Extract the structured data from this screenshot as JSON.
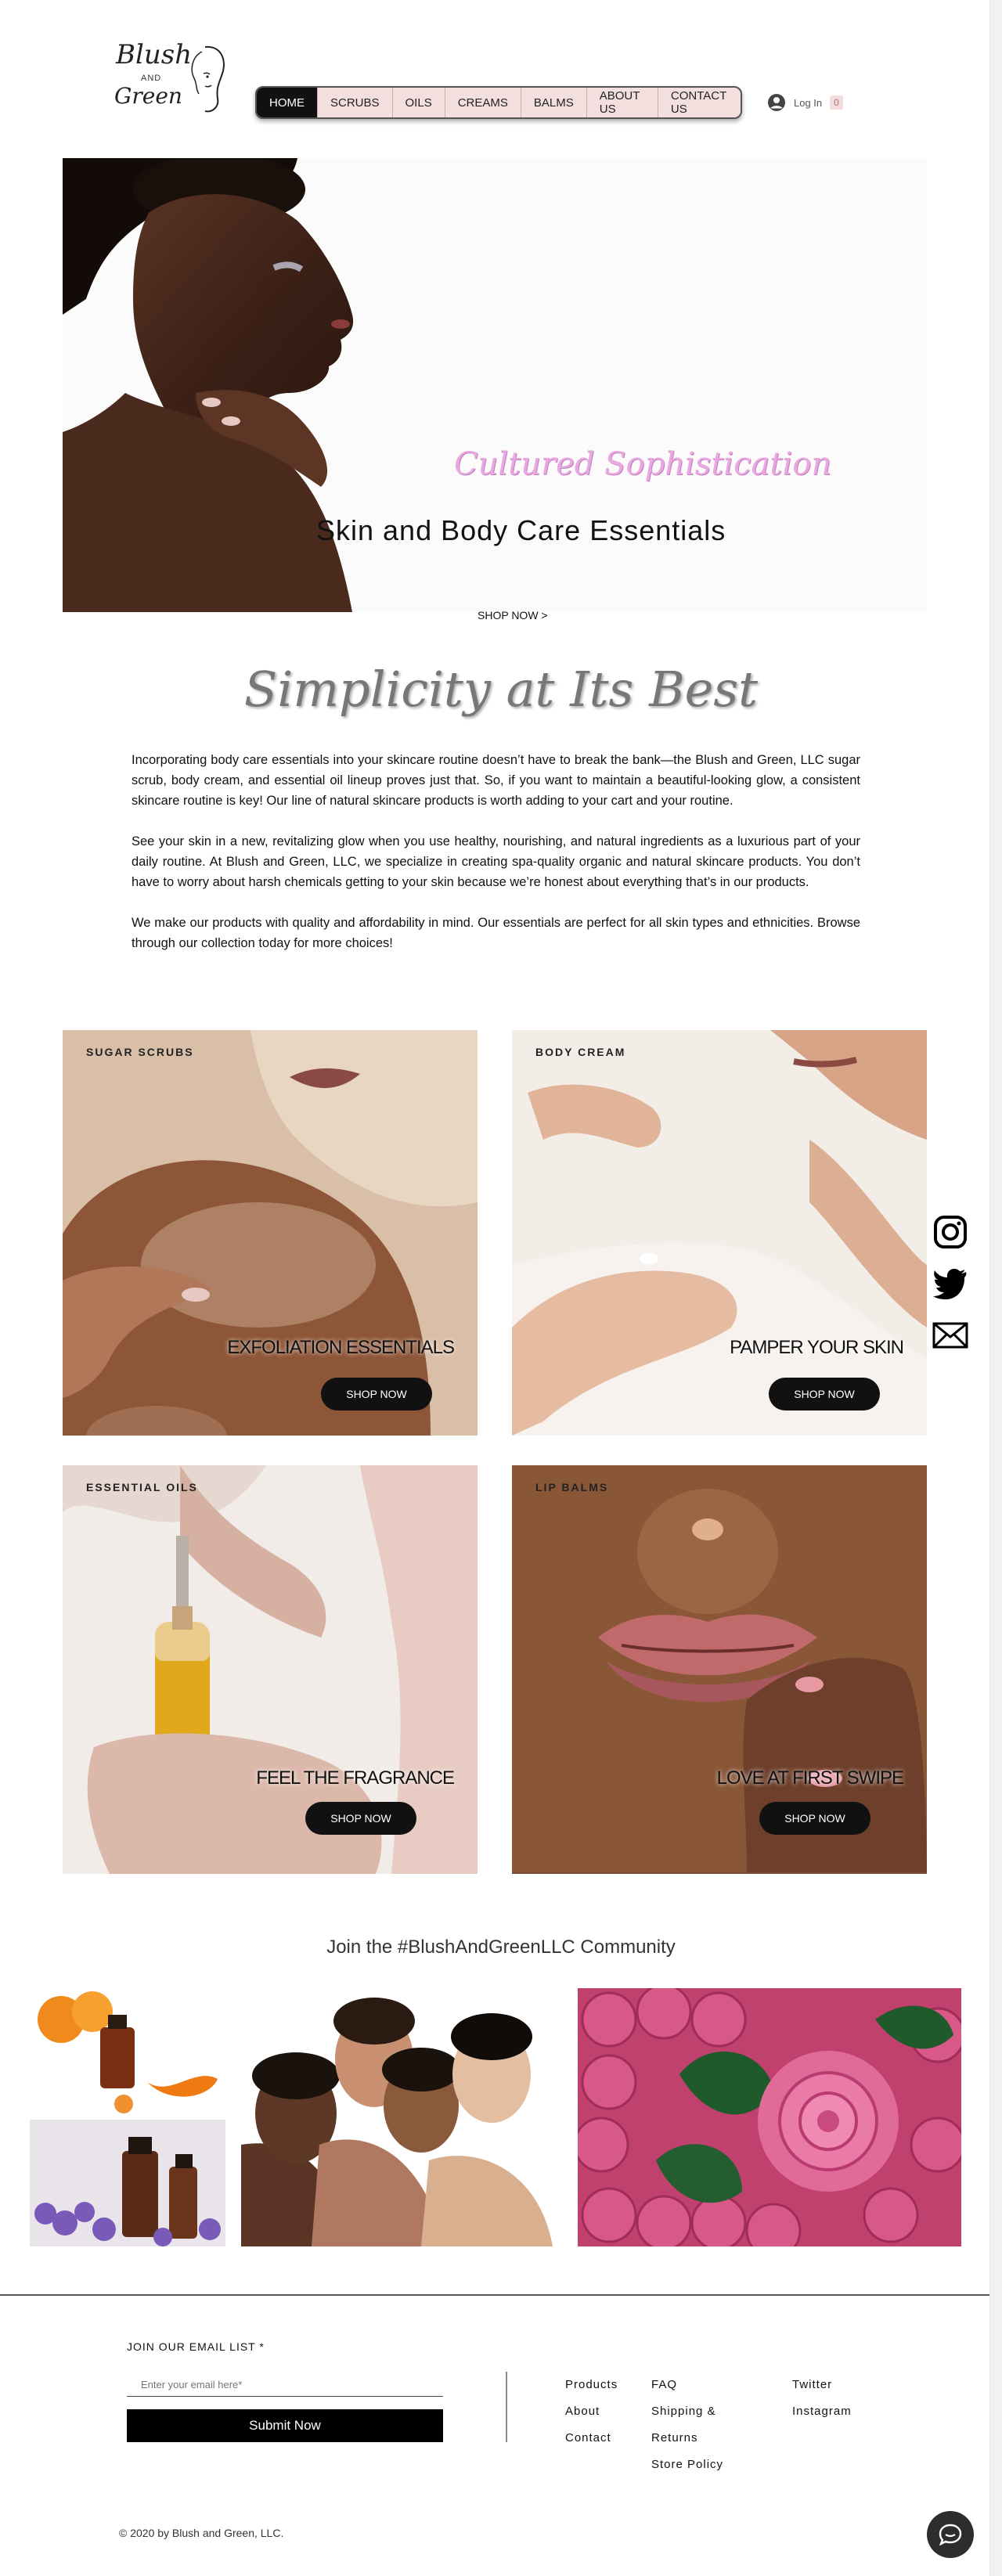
{
  "header": {
    "logo": {
      "line1": "Blush",
      "line2": "AND",
      "line3": "Green"
    },
    "nav": [
      {
        "label": "HOME",
        "name": "nav-home"
      },
      {
        "label": "SCRUBS",
        "name": "nav-scrubs"
      },
      {
        "label": "OILS",
        "name": "nav-oils"
      },
      {
        "label": "CREAMS",
        "name": "nav-creams"
      },
      {
        "label": "BALMS",
        "name": "nav-balms"
      },
      {
        "label": "ABOUT US",
        "name": "nav-about-us"
      },
      {
        "label": "CONTACT US",
        "name": "nav-contact-us"
      }
    ],
    "login_label": "Log In",
    "cart_count": "0"
  },
  "hero": {
    "tagline": "Cultured Sophistication",
    "title": "Skin and Body Care Essentials",
    "cta": "SHOP NOW >"
  },
  "intro": {
    "title": "Simplicity at Its Best",
    "paragraphs": [
      "Incorporating body care essentials into your skincare routine doesn’t have to break the bank—the Blush and Green, LLC sugar scrub, body cream, and essential oil lineup proves just that. So, if you want to maintain a beautiful-looking glow, a consistent skincare routine is key! Our line of natural skincare products is worth adding to your cart and your routine.",
      "See your skin in a new, revitalizing glow when you use healthy, nourishing, and natural ingredients as a luxurious part of your daily routine. At Blush and Green, LLC, we specialize in creating spa-quality organic and natural skincare products. You don’t have to worry about harsh chemicals getting to your skin because we’re honest about everything that’s in our products.",
      "We make our products with quality and affordability in mind. Our essentials are perfect for all skin types and ethnicities. Browse through our collection today for more choices!"
    ]
  },
  "tiles": [
    {
      "category": "SUGAR SCRUBS",
      "tagline": "EXFOLIATION ESSENTIALS",
      "button": "SHOP NOW"
    },
    {
      "category": "BODY CREAM",
      "tagline": "PAMPER YOUR SKIN",
      "button": "SHOP NOW"
    },
    {
      "category": "ESSENTIAL OILS",
      "tagline": "FEEL THE FRAGRANCE",
      "button": "SHOP NOW"
    },
    {
      "category": "LIP BALMS",
      "tagline": "LOVE AT FIRST SWIPE",
      "button": "SHOP NOW"
    }
  ],
  "social": [
    "instagram-icon",
    "twitter-icon",
    "mail-icon"
  ],
  "community": {
    "title": "Join the #BlushAndGreenLLC Community"
  },
  "footer": {
    "email_label": "JOIN OUR EMAIL LIST *",
    "email_placeholder": "Enter your email here*",
    "submit": "Submit Now",
    "col1": [
      "Products",
      "About",
      "Contact"
    ],
    "col2": [
      "FAQ",
      "Shipping &",
      "Returns",
      "Store Policy"
    ],
    "col3": [
      "Twitter",
      "Instagram"
    ],
    "copyright": "© 2020 by Blush and Green, LLC."
  },
  "colors": {
    "nav_bg": "#f4dfdf",
    "accent_pink": "#e8a8e0",
    "button": "#111111"
  }
}
